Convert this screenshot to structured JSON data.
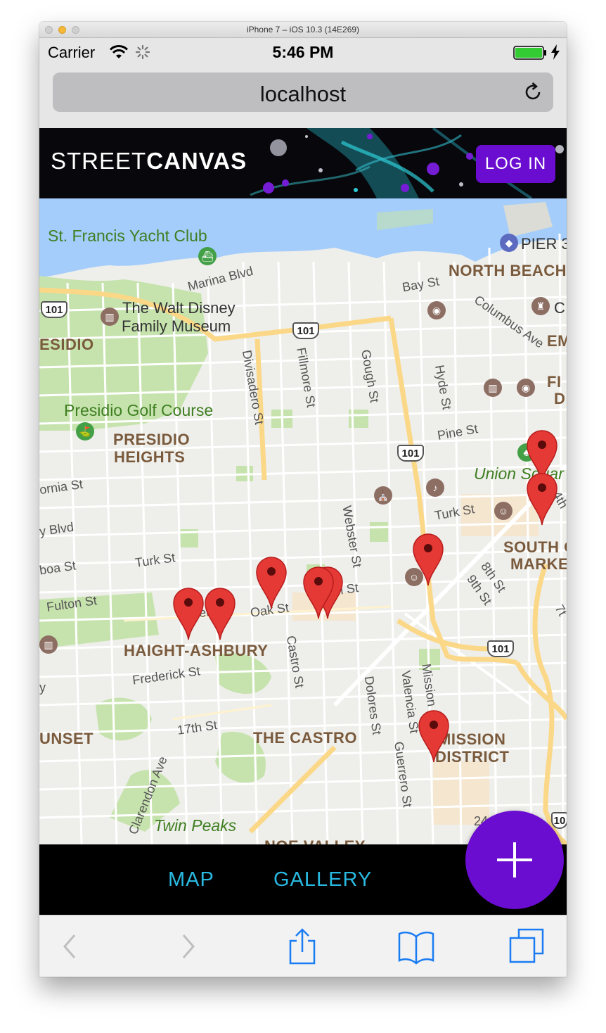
{
  "window": {
    "title": "iPhone 7 – iOS 10.3 (14E269)"
  },
  "status_bar": {
    "carrier": "Carrier",
    "time": "5:46 PM",
    "battery_color": "#33cc33"
  },
  "browser": {
    "url": "localhost"
  },
  "app": {
    "brand_light": "STREET",
    "brand_bold": "CANVAS",
    "login_label": "LOG IN",
    "accent_color": "#6a0dd0"
  },
  "map": {
    "labels": {
      "yacht_club": "St. Francis Yacht Club",
      "pier": "PIER 3",
      "north_beach": "NORTH BEACH",
      "marina_blvd": "Marina Blvd",
      "bay_st": "Bay St",
      "columbus": "Columbus Ave",
      "walt_disney_1": "The Walt Disney",
      "walt_disney_2": "Family Museum",
      "presidio": "ESIDIO",
      "divisadero": "Divisadero St",
      "fillmore": "Fillmore St",
      "gough": "Gough St",
      "hyde": "Hyde St",
      "em": "EM",
      "fi": "FI",
      "d": "D",
      "c": "C",
      "presidio_golf": "Presidio Golf Course",
      "presidio_heights_1": "PRESIDIO",
      "presidio_heights_2": "HEIGHTS",
      "pine_st": "Pine St",
      "union_square": "Union Squar",
      "california_st": "ornia St",
      "turk_st_east": "Turk St",
      "blvd": "y Blvd",
      "webster": "Webster St",
      "south_of_market_1": "SOUTH O",
      "south_of_market_2": "MARKE",
      "fourth": "4th",
      "eighth": "8th St",
      "ninth": "9th St",
      "seventh": "7t",
      "turk_st_west": "Turk St",
      "boa_st": "boa St",
      "fulton_st": "Fulton St",
      "oak_st": "Oak St",
      "hell_st": "ell",
      "haight_st": "ll St",
      "haight_ashbury": "HAIGHT-ASHBURY",
      "castro_st": "Castro St",
      "dolores_st": "Dolores St",
      "valencia_st": "Valencia St",
      "mission_st": "Mission St",
      "frederick_st": "Frederick St",
      "seventeenth_st": "17th St",
      "sunset": "UNSET",
      "the_castro": "THE CASTRO",
      "guerrero_st": "Guerrero St",
      "mission_district_1": "MISSION",
      "mission_district_2": "DISTRICT",
      "clarendon": "Clarendon Ave",
      "twin_peaks": "Twin Peaks",
      "noe_valley": "NOE VALLEY",
      "twenty_fourth": "24",
      "y": "y"
    },
    "highways": [
      "101",
      "101",
      "101",
      "101",
      "10"
    ],
    "pin_color": "#e53935",
    "pin_count": 10
  },
  "bottom_nav": {
    "map_label": "MAP",
    "gallery_label": "GALLERY",
    "link_color": "#29b9e0"
  },
  "toolbar": {
    "icons": [
      "back-icon",
      "forward-icon",
      "share-icon",
      "bookmarks-icon",
      "tabs-icon"
    ],
    "icon_color": "#1a7cf3"
  }
}
